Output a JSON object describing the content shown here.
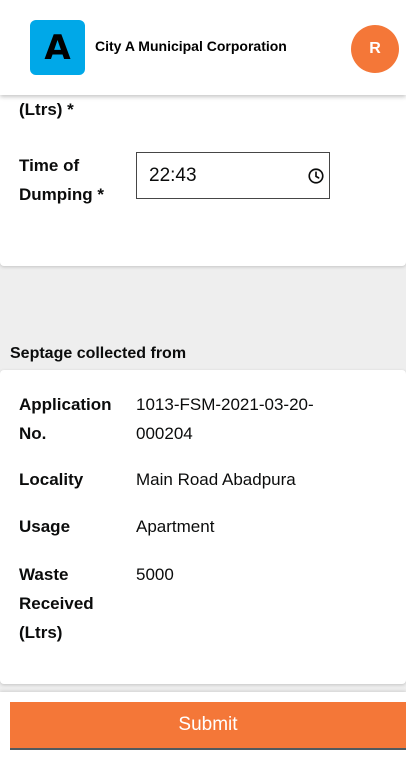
{
  "header": {
    "logo_letter": "A",
    "city_name": "City A Municipal Corporation",
    "avatar_initial": "R"
  },
  "dumping": {
    "ltrs_label_fragment": "(Ltrs) *",
    "time_label": "Time of Dumping *",
    "time_value": "22:43"
  },
  "septage": {
    "heading": "Septage collected from",
    "rows": [
      {
        "label": "Application No.",
        "value": "1013-FSM-2021-03-20-000204"
      },
      {
        "label": "Locality",
        "value": "Main Road Abadpura"
      },
      {
        "label": "Usage",
        "value": "Apartment"
      },
      {
        "label": "Waste Received (Ltrs)",
        "value": "5000"
      }
    ]
  },
  "footer": {
    "submit_label": "Submit"
  },
  "colors": {
    "accent": "#f47738",
    "logo_bg": "#00a8e8",
    "background": "#eeeeee"
  }
}
